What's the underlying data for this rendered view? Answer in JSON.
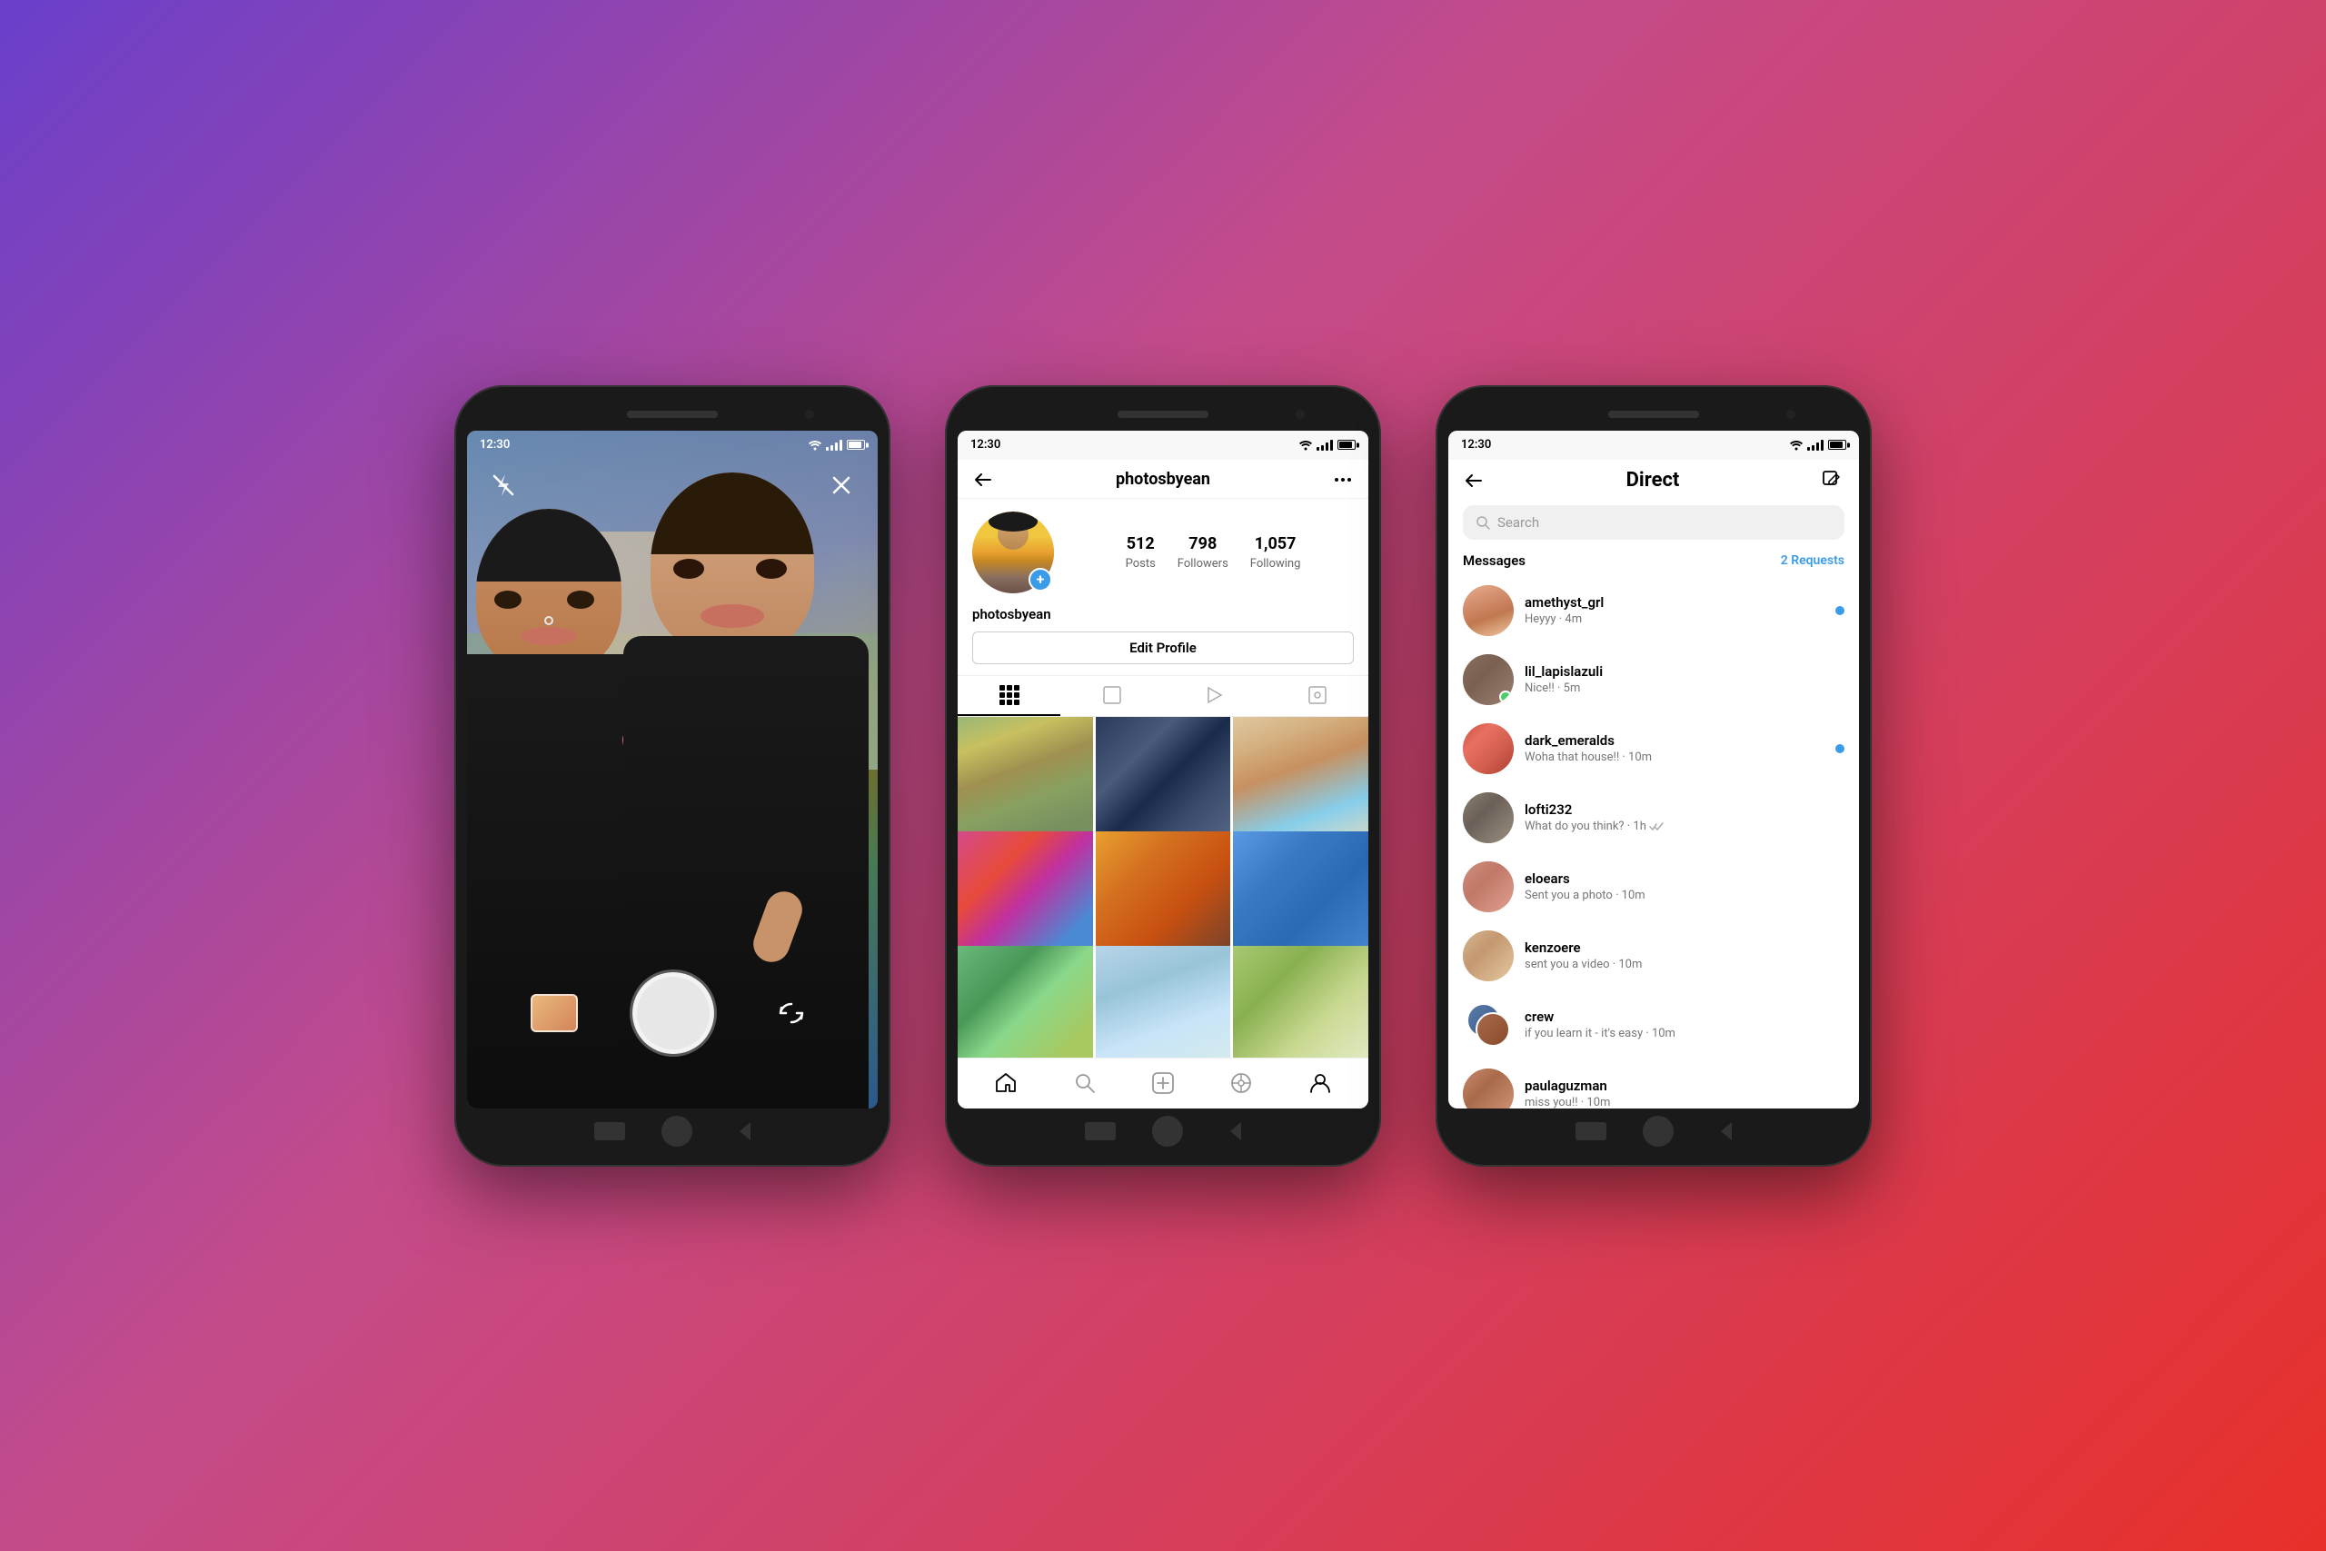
{
  "background": {
    "gradient": "linear-gradient(135deg, #6a3fcb 0%, #c44b8a 40%, #e8302a 100%)"
  },
  "phone1": {
    "type": "camera",
    "status_time": "12:30",
    "top_icons": {
      "flash": "flash-off-icon",
      "close": "close-icon"
    },
    "bottom_controls": {
      "shutter": "shutter-button",
      "gallery": "gallery-thumb",
      "flip": "flip-camera-icon"
    }
  },
  "phone2": {
    "type": "profile",
    "status_time": "12:30",
    "header": {
      "back_icon": "back-arrow-icon",
      "username": "photosbyean",
      "more_icon": "more-options-icon"
    },
    "stats": {
      "posts_count": "512",
      "posts_label": "Posts",
      "followers_count": "798",
      "followers_label": "Followers",
      "following_count": "1,057",
      "following_label": "Following"
    },
    "profile_name": "photosbyean",
    "edit_profile_btn": "Edit Profile",
    "tabs": [
      "grid",
      "single",
      "video",
      "tagged"
    ],
    "photos": [
      {
        "id": 1,
        "color": "photo-1"
      },
      {
        "id": 2,
        "color": "photo-2"
      },
      {
        "id": 3,
        "color": "photo-3"
      },
      {
        "id": 4,
        "color": "photo-4"
      },
      {
        "id": 5,
        "color": "photo-5"
      },
      {
        "id": 6,
        "color": "photo-6"
      },
      {
        "id": 7,
        "color": "photo-7"
      },
      {
        "id": 8,
        "color": "photo-8"
      },
      {
        "id": 9,
        "color": "photo-9"
      }
    ],
    "bottom_nav": [
      "home",
      "search",
      "add",
      "reels",
      "profile"
    ]
  },
  "phone3": {
    "type": "direct",
    "status_time": "12:30",
    "header": {
      "back_icon": "back-arrow-icon",
      "title": "Direct",
      "compose_icon": "compose-icon"
    },
    "search_placeholder": "Search",
    "messages_label": "Messages",
    "requests_label": "2 Requests",
    "messages": [
      {
        "username": "amethyst_grl",
        "preview": "Heyyy · 4m",
        "avatar_class": "av-amethyst",
        "online": false,
        "unread": true
      },
      {
        "username": "lil_lapislazuli",
        "preview": "Nice!! · 5m",
        "avatar_class": "av-lapis",
        "online": true,
        "unread": false
      },
      {
        "username": "dark_emeralds",
        "preview": "Woha that house!! · 10m",
        "avatar_class": "av-dark",
        "online": false,
        "unread": true
      },
      {
        "username": "lofti232",
        "preview": "What do you think? · 1h",
        "avatar_class": "av-lofti",
        "online": false,
        "unread": false
      },
      {
        "username": "eloears",
        "preview": "Sent you a photo · 10m",
        "avatar_class": "av-elo",
        "online": false,
        "unread": false
      },
      {
        "username": "kenzoere",
        "preview": "sent you a video · 10m",
        "avatar_class": "av-ken",
        "online": false,
        "unread": false
      },
      {
        "username": "crew",
        "preview": "if you learn it - it's easy · 10m",
        "avatar_class": "av-crew",
        "online": false,
        "unread": false,
        "is_group": true
      },
      {
        "username": "paulaguzman",
        "preview": "miss you!! · 10m",
        "avatar_class": "av-paula",
        "online": false,
        "unread": false
      }
    ]
  }
}
